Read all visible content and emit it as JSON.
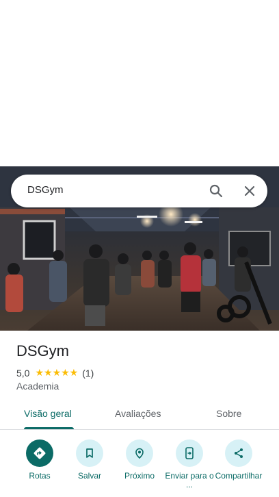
{
  "search": {
    "query": "DSGym"
  },
  "place": {
    "title": "DSGym",
    "rating": "5,0",
    "stars": "★★★★★",
    "review_count": "(1)",
    "category": "Academia"
  },
  "tabs": [
    {
      "label": "Visão geral",
      "active": true
    },
    {
      "label": "Avaliações",
      "active": false
    },
    {
      "label": "Sobre",
      "active": false
    }
  ],
  "actions": [
    {
      "label": "Rotas",
      "icon": "directions-icon"
    },
    {
      "label": "Salvar",
      "icon": "bookmark-icon"
    },
    {
      "label": "Próximo",
      "icon": "nearby-icon"
    },
    {
      "label": "Enviar para o ...",
      "icon": "send-to-phone-icon"
    },
    {
      "label": "Compartilhar",
      "icon": "share-icon"
    }
  ],
  "colors": {
    "accent": "#0b6b66",
    "chip_bg": "#d7f1f6",
    "star": "#fbbc04"
  }
}
